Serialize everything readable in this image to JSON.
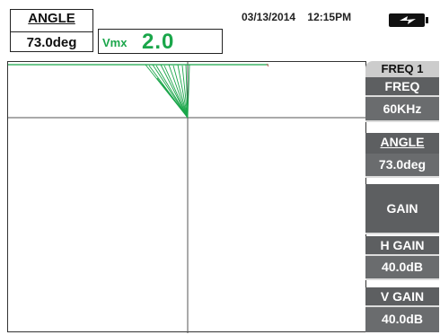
{
  "header": {
    "angle_label": "ANGLE",
    "angle_value": "73.0deg",
    "vmx_label": "Vmx",
    "vmx_value": "2.0",
    "date": "03/13/2014",
    "time": "12:15PM"
  },
  "icons": {
    "battery": "battery-charging-icon"
  },
  "menu": {
    "tab": "FREQ 1",
    "freq_label": "FREQ",
    "freq_value": "60KHz",
    "angle_label": "ANGLE",
    "angle_value": "73.0deg",
    "gain_label": "GAIN",
    "hgain_label": "H GAIN",
    "hgain_value": "40.0dB",
    "vgain_label": "V GAIN",
    "vgain_value": "40.0dB"
  },
  "colors": {
    "signal": "#1aa64a",
    "menu_bg": "#5d5f61",
    "tab_bg": "#cccccc"
  }
}
